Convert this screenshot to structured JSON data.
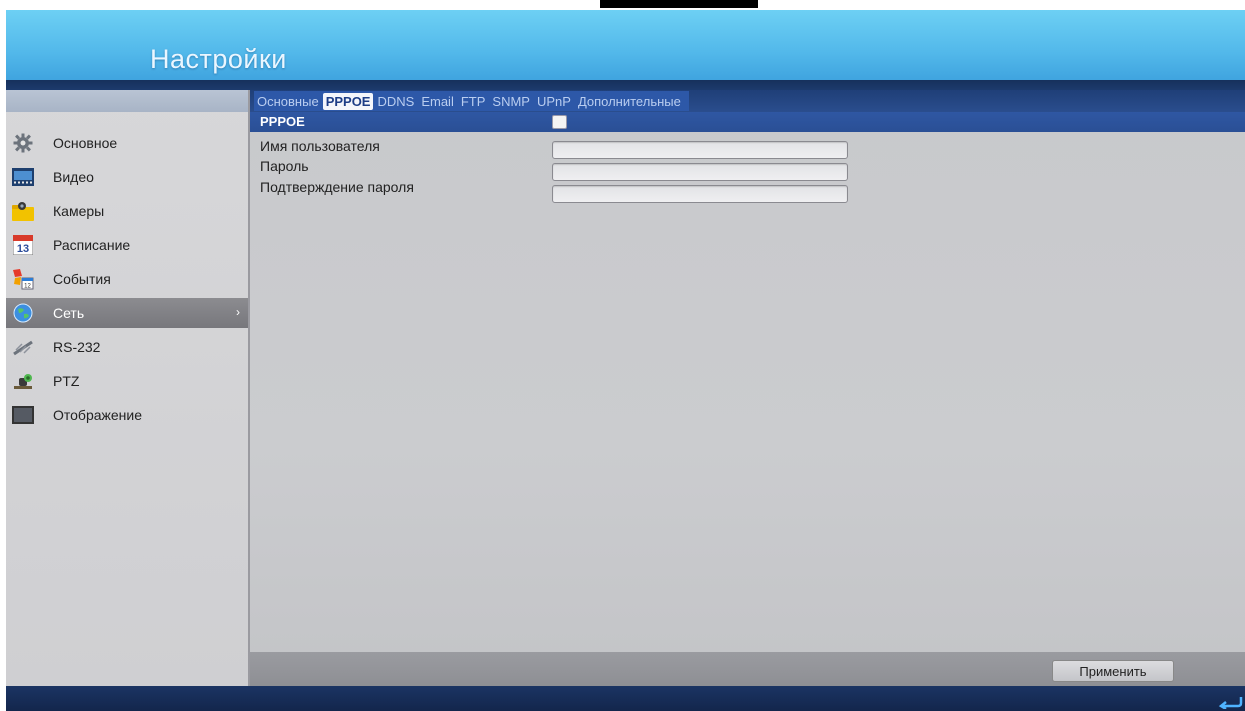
{
  "header": {
    "title": "Настройки"
  },
  "sidebar": {
    "items": [
      {
        "label": "Основное",
        "icon": "gear-icon"
      },
      {
        "label": "Видео",
        "icon": "video-film-icon"
      },
      {
        "label": "Камеры",
        "icon": "camera-folder-icon"
      },
      {
        "label": "Расписание",
        "icon": "calendar-icon"
      },
      {
        "label": "События",
        "icon": "event-flag-icon"
      },
      {
        "label": "Сеть",
        "icon": "network-globe-icon",
        "selected": true,
        "chevron": "›"
      },
      {
        "label": "RS-232",
        "icon": "serial-port-icon"
      },
      {
        "label": "PTZ",
        "icon": "ptz-camera-icon"
      },
      {
        "label": "Отображение",
        "icon": "display-monitor-icon"
      }
    ]
  },
  "tabs": [
    {
      "label": "Основные",
      "active": false
    },
    {
      "label": "PPPOE",
      "active": true
    },
    {
      "label": "DDNS",
      "active": false
    },
    {
      "label": "Email",
      "active": false
    },
    {
      "label": "FTP",
      "active": false
    },
    {
      "label": "SNMP",
      "active": false
    },
    {
      "label": "UPnP",
      "active": false
    },
    {
      "label": "Дополнительные",
      "active": false
    }
  ],
  "pppoe": {
    "label": "PPPOE",
    "enabled": false
  },
  "form": {
    "username_label": "Имя пользователя",
    "username_value": "",
    "password_label": "Пароль",
    "password_value": "",
    "confirm_label": "Подтверждение пароля",
    "confirm_value": ""
  },
  "footer": {
    "apply_label": "Применить"
  },
  "colors": {
    "header_blue": "#52b8ea",
    "tab_bar_blue": "#2d58a8",
    "panel_gray": "#c9cacd",
    "sidebar_selected": "#7f7f84"
  }
}
